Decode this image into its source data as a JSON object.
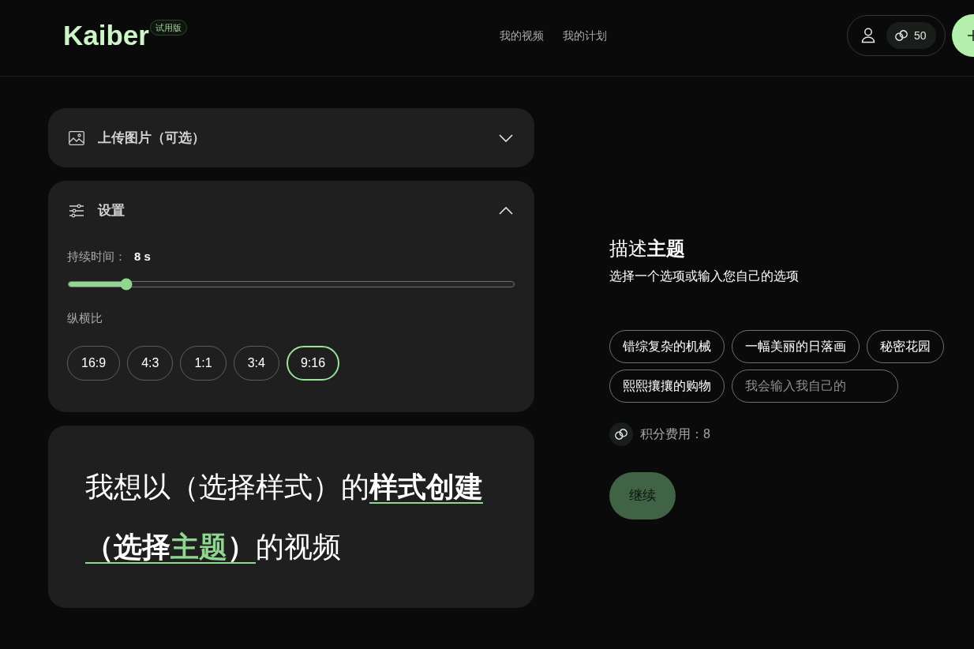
{
  "header": {
    "logo": "Kaiber",
    "badge": "试用版",
    "nav": [
      {
        "label": "我的视频"
      },
      {
        "label": "我的计划"
      }
    ],
    "credits": "50"
  },
  "sections": [
    {
      "kind": "upload",
      "title": "上传图片（可选）",
      "expanded": false
    },
    {
      "kind": "settings",
      "title": "设置",
      "expanded": true,
      "duration": {
        "label": "持续时间：",
        "value": "8 s",
        "level": 0.13
      },
      "aspect": {
        "label": "纵横比",
        "options": [
          {
            "label": "16:9",
            "selected": false
          },
          {
            "label": "4:3",
            "selected": false
          },
          {
            "label": "1:1",
            "selected": false
          },
          {
            "label": "3:4",
            "selected": false
          },
          {
            "label": "9:16",
            "selected": true
          }
        ]
      }
    }
  ],
  "prompt": [
    {
      "kind": "text",
      "text": "我想以（选择样式）的"
    },
    {
      "kind": "blank",
      "parts": [
        {
          "text": "样式创建",
          "highlight": false
        }
      ]
    },
    {
      "kind": "blank",
      "parts": [
        {
          "text": "（选择",
          "highlight": false
        },
        {
          "text": "主题",
          "highlight": true
        },
        {
          "text": "）",
          "highlight": false
        }
      ]
    },
    {
      "kind": "text",
      "text": "的视频"
    }
  ],
  "subject": {
    "title": "描述**主题**",
    "subtitle": "选择一个选项或输入您自己的选项",
    "options": [
      {
        "label": "错综复杂的机械",
        "selected": false
      },
      {
        "label": "一幅美丽的日落画",
        "selected": false
      },
      {
        "label": "秘密花园",
        "selected": false
      },
      {
        "label": "熙熙攘攘的购物",
        "selected": false
      }
    ],
    "custom": {
      "placeholder": "我会输入我自己的"
    },
    "cost": "积分费用：8",
    "continue": {
      "label": "继续",
      "disabled": true
    }
  }
}
